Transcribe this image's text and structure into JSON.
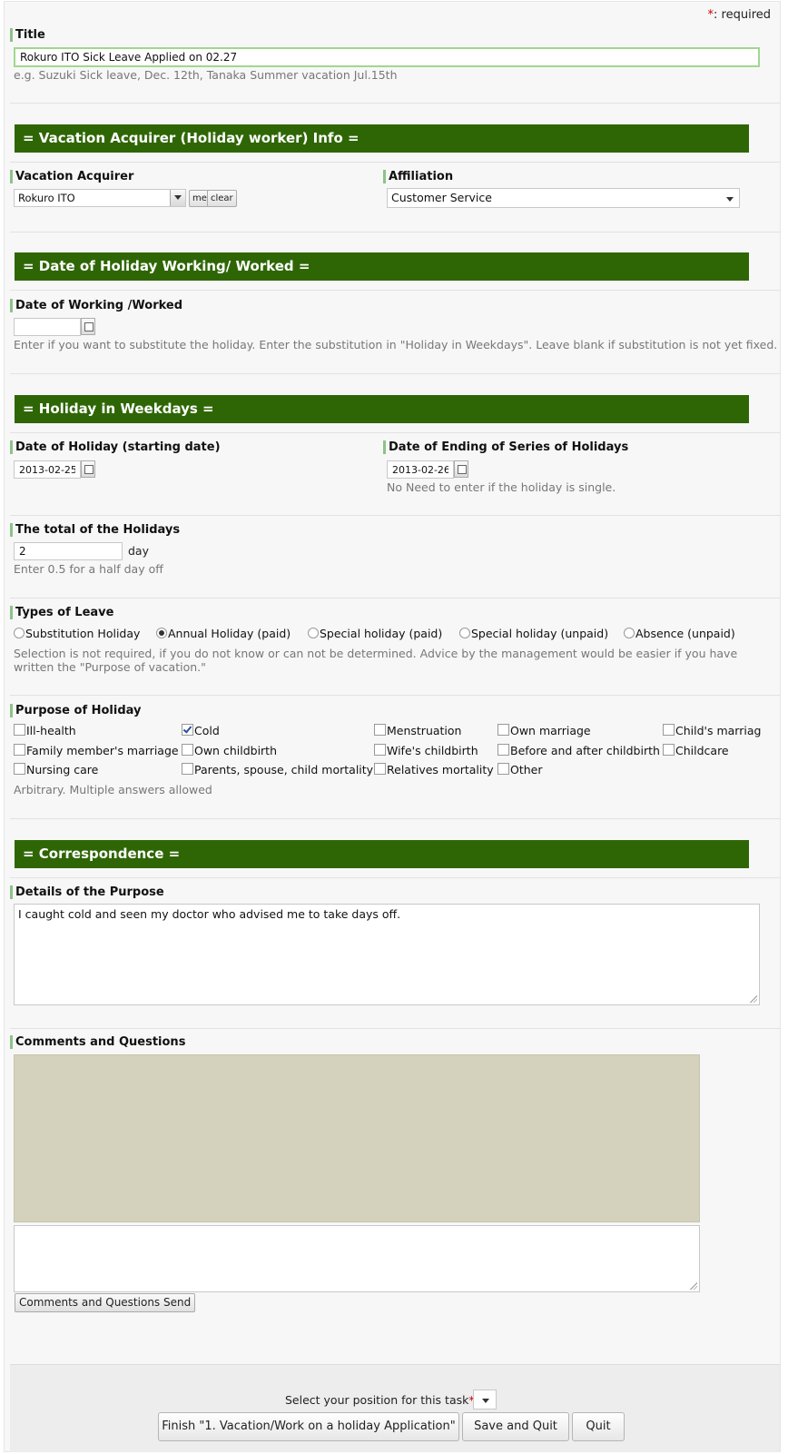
{
  "required_note": {
    "star": "*",
    "text": ": required"
  },
  "title_field": {
    "label": "Title",
    "value": "Rokuro ITO Sick Leave Applied on 02.27",
    "hint": "e.g. Suzuki Sick leave, Dec. 12th, Tanaka Summer vacation Jul.15th"
  },
  "sections": {
    "acquirer": "= Vacation Acquirer (Holiday worker) Info =",
    "date_worked": "= Date of Holiday Working/ Worked =",
    "weekdays": "= Holiday in Weekdays =",
    "correspondence": "= Correspondence ="
  },
  "acquirer": {
    "label": "Vacation Acquirer",
    "value": "Rokuro ITO",
    "me_label": "me",
    "clear_label": "clear"
  },
  "affiliation": {
    "label": "Affiliation",
    "value": "Customer Service"
  },
  "date_worked": {
    "label": "Date of Working /Worked",
    "value": "",
    "hint": "Enter if you want to substitute the holiday. Enter the substitution in \"Holiday in Weekdays\". Leave blank if substitution is not yet fixed."
  },
  "holiday_start": {
    "label": "Date of Holiday (starting date)",
    "value": "2013-02-25"
  },
  "holiday_end": {
    "label": "Date of Ending of Series of Holidays",
    "value": "2013-02-26",
    "hint": "No Need to enter if the holiday is single."
  },
  "total": {
    "label": "The total of the Holidays",
    "value": "2",
    "unit": "day",
    "hint": "Enter 0.5 for a half day off"
  },
  "leave_types": {
    "label": "Types of Leave",
    "options": [
      {
        "label": "Substitution Holiday",
        "selected": false
      },
      {
        "label": "Annual Holiday (paid)",
        "selected": true
      },
      {
        "label": "Special holiday (paid)",
        "selected": false
      },
      {
        "label": "Special holiday (unpaid)",
        "selected": false
      },
      {
        "label": "Absence (unpaid)",
        "selected": false
      }
    ],
    "hint_line1": "Selection is not required, if you do not know or can not be determined. Advice by the management would be easier if you have",
    "hint_line2": "written the \"Purpose of vacation.\""
  },
  "purpose": {
    "label": "Purpose of Holiday",
    "options": [
      {
        "label": "Ill-health",
        "checked": false
      },
      {
        "label": "Cold",
        "checked": true
      },
      {
        "label": "Menstruation",
        "checked": false
      },
      {
        "label": "Own marriage",
        "checked": false
      },
      {
        "label": "Child's marriag",
        "checked": false
      },
      {
        "label": "Family member's marriage",
        "checked": false
      },
      {
        "label": "Own childbirth",
        "checked": false
      },
      {
        "label": "Wife's childbirth",
        "checked": false
      },
      {
        "label": "Before and after childbirth",
        "checked": false
      },
      {
        "label": "Childcare",
        "checked": false
      },
      {
        "label": "Nursing care",
        "checked": false
      },
      {
        "label": "Parents, spouse, child mortality",
        "checked": false
      },
      {
        "label": "Relatives mortality",
        "checked": false
      },
      {
        "label": "Other",
        "checked": false
      }
    ],
    "hint": "Arbitrary. Multiple answers allowed"
  },
  "details": {
    "label": "Details of the Purpose",
    "value": "I caught cold and seen my doctor who advised me to take days off."
  },
  "comments": {
    "label": "Comments and Questions",
    "input_value": "",
    "send_label": "Comments and Questions Send"
  },
  "footer": {
    "position_label": "Select your position for this task",
    "position_star": "*",
    "finish_label": "Finish \"1. Vacation/Work on a holiday Application\"",
    "save_label": "Save and Quit",
    "quit_label": "Quit"
  }
}
